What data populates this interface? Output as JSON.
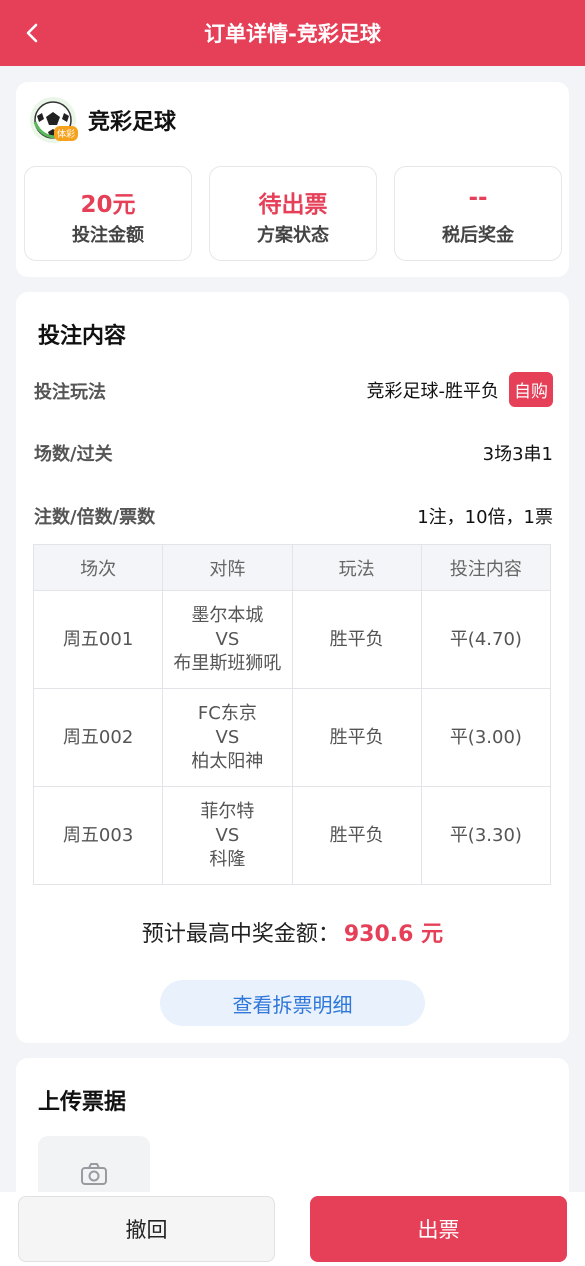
{
  "header": {
    "title": "订单详情-竞彩足球"
  },
  "lottery": {
    "name": "竞彩足球",
    "badge": "体彩"
  },
  "stats": [
    {
      "value": "20元",
      "label": "投注金额"
    },
    {
      "value": "待出票",
      "label": "方案状态"
    },
    {
      "value": "--",
      "label": "税后奖金"
    }
  ],
  "bet": {
    "section_title": "投注内容",
    "play_label": "投注玩法",
    "play_value": "竞彩足球-胜平负",
    "self_buy": "自购",
    "pass_label": "场数/过关",
    "pass_value": "3场3串1",
    "count_label": "注数/倍数/票数",
    "count_value": "1注，10倍，1票"
  },
  "table": {
    "headers": [
      "场次",
      "对阵",
      "玩法",
      "投注内容"
    ],
    "rows": [
      {
        "match_no": "周五001",
        "home": "墨尔本城",
        "vs": "VS",
        "away": "布里斯班狮吼",
        "play": "胜平负",
        "pick": "平(4.70)"
      },
      {
        "match_no": "周五002",
        "home": "FC东京",
        "vs": "VS",
        "away": "柏太阳神",
        "play": "胜平负",
        "pick": "平(3.00)"
      },
      {
        "match_no": "周五003",
        "home": "菲尔特",
        "vs": "VS",
        "away": "科隆",
        "play": "胜平负",
        "pick": "平(3.30)"
      }
    ]
  },
  "prize": {
    "label": "预计最高中奖金额：",
    "value": "930.6 元"
  },
  "detail_button": "查看拆票明细",
  "upload": {
    "title": "上传票据",
    "icon": "camera-icon"
  },
  "footer": {
    "cancel": "撤回",
    "issue": "出票"
  },
  "colors": {
    "accent": "#e63f58",
    "link": "#2f78d9"
  }
}
